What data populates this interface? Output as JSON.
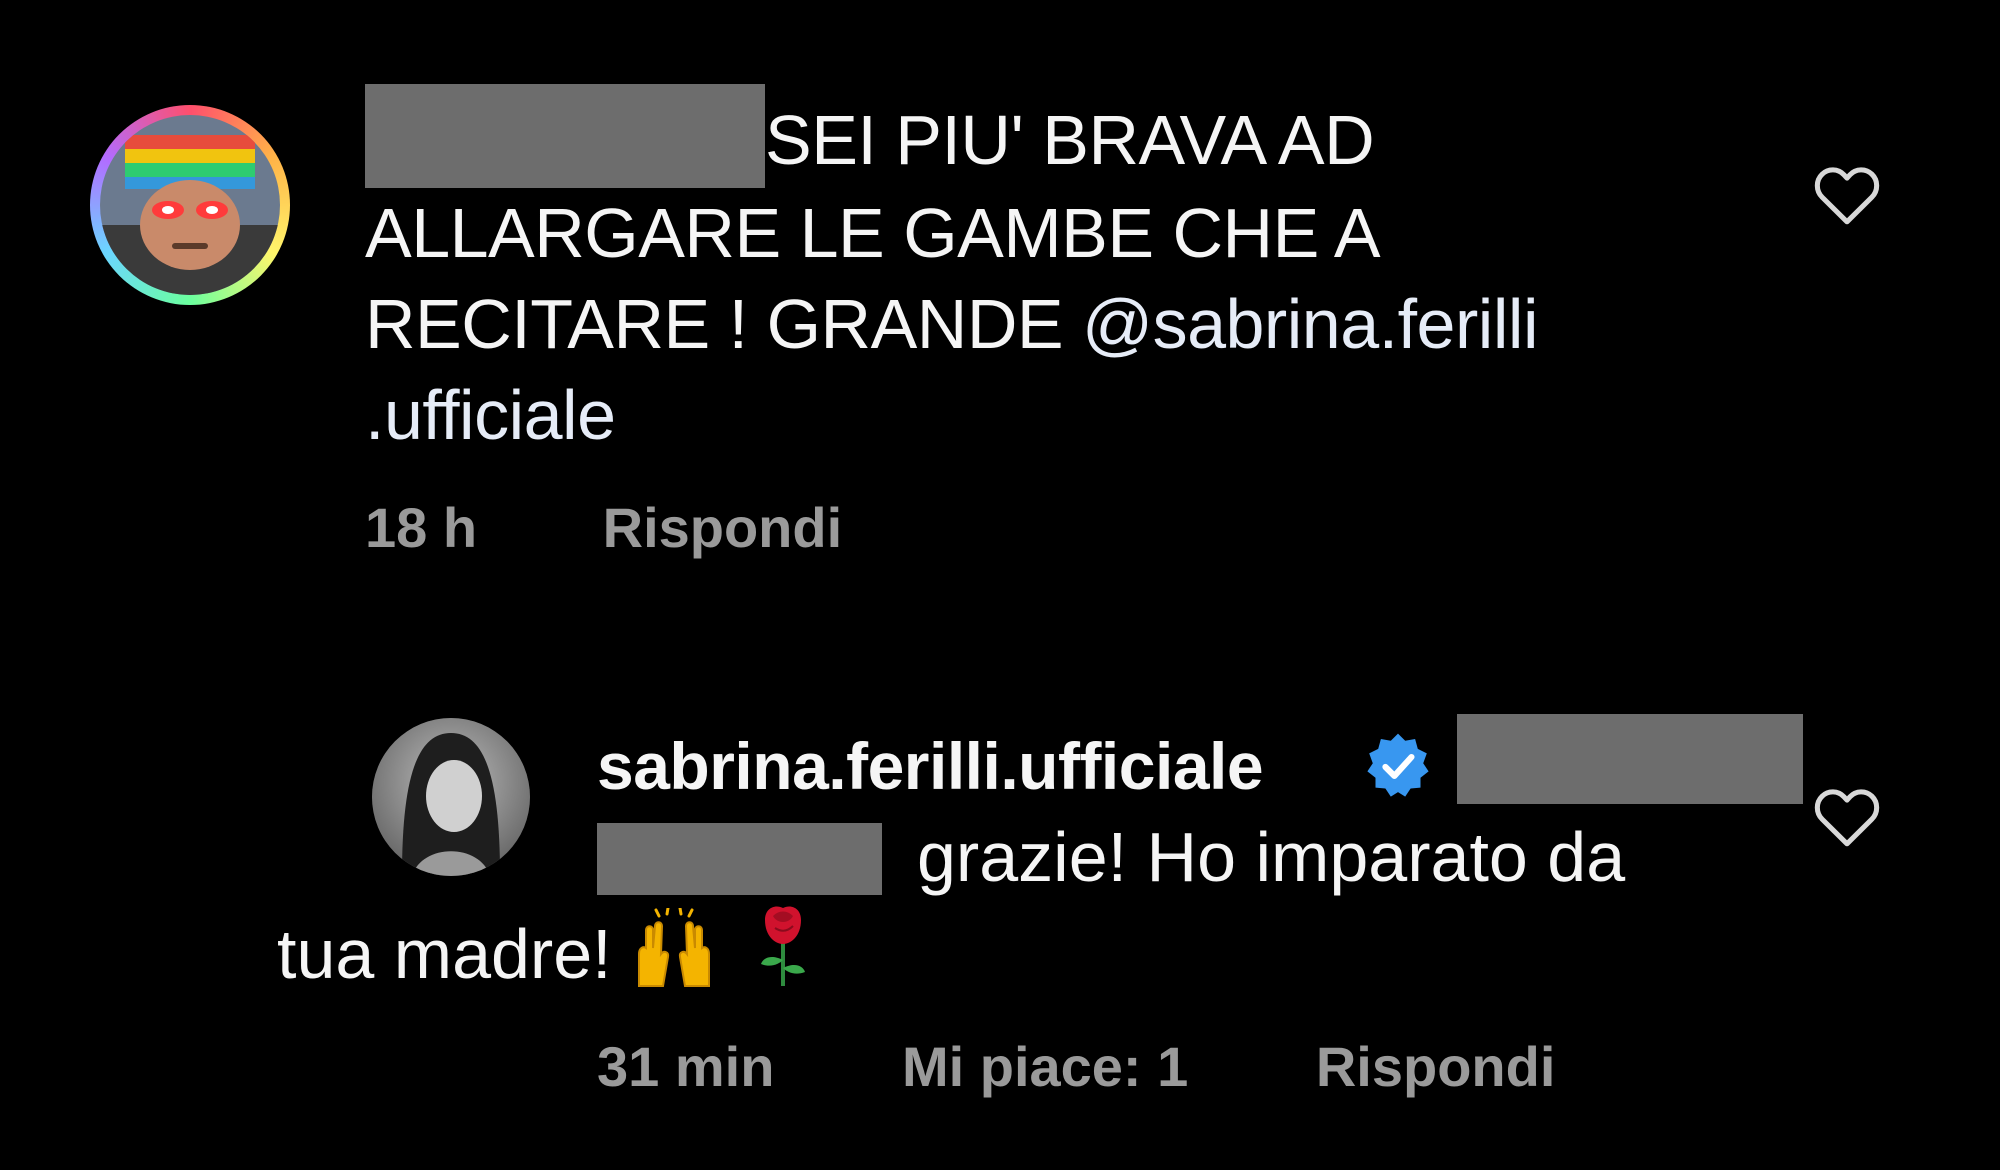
{
  "comment": {
    "text_line_1": "SEI PIU' BRAVA AD",
    "text_line_2": "ALLARGARE LE GAMBE CHE A",
    "text_line_3_prefix": "RECITARE ! GRANDE ",
    "mention": "@sabrina.ferilli",
    "mention_suffix": ".ufficiale",
    "time": "18 h",
    "reply_label": "Rispondi",
    "redacted_username": true
  },
  "reply": {
    "username": "sabrina.ferilli.ufficiale",
    "verified": true,
    "text_line_1": "grazie! Ho imparato da",
    "text_line_2": "tua madre!",
    "emojis": [
      "raising-hands-icon",
      "rose-icon"
    ],
    "time": "31 min",
    "likes_label": "Mi piace: 1",
    "reply_label": "Rispondi"
  },
  "colors": {
    "background": "#000000",
    "text": "#f5f5f5",
    "meta": "#9a9a9a",
    "verified_blue": "#3897f0",
    "redaction": "#6d6d6d"
  }
}
